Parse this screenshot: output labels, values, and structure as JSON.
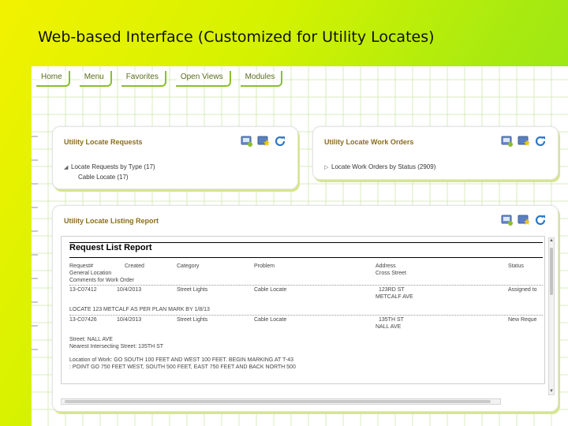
{
  "slide": {
    "title": "Web-based Interface (Customized for Utility Locates)"
  },
  "nav": [
    "Home",
    "Menu",
    "Favorites",
    "Open Views",
    "Modules"
  ],
  "requests_panel": {
    "title": "Utility Locate Requests",
    "tree": [
      {
        "label": "Locate Requests by Type (17)",
        "expanded": true
      },
      {
        "label": "Cable Locate (17)"
      }
    ]
  },
  "workorders_panel": {
    "title": "Utility Locate Work Orders",
    "tree": [
      {
        "label": "Locate Work Orders by Status (2909)",
        "expanded": false
      }
    ]
  },
  "listing_panel": {
    "title": "Utility Locate Listing Report",
    "report": {
      "title": "Request List Report",
      "headers": {
        "request": "Request#",
        "general_location": "General Location",
        "comments": "Comments for Work Order",
        "created": "Created",
        "category": "Category",
        "problem": "Problem",
        "address": "Address",
        "cross_street": "Cross Street",
        "status": "Status"
      },
      "rows": [
        {
          "request": "13-C07412",
          "created": "10/4/2013",
          "category": "Street Lights",
          "problem": "Cable Locate",
          "address": "123RD ST",
          "cross_street": "METCALF AVE",
          "status": "Assigned to",
          "notes": [
            "LOCATE 123 METCALF AS PER PLAN   MARK BY 1/8/13"
          ]
        },
        {
          "request": "13-C07426",
          "created": "10/4/2013",
          "category": "Street Lights",
          "problem": "Cable Locate",
          "address": "135TH ST",
          "cross_street": "NALL AVE",
          "status": "New Reque",
          "notes": [
            "Street: NALL AVE",
            "Nearest Intersecting Street: 135TH ST",
            "Location of Work: GO SOUTH 100 FEET AND WEST 100 FEET. BEGIN MARKING AT T-43",
            ": POINT   GO 750 FEET WEST, SOUTH 500 FEET, EAST 750 FEET AND BACK NORTH 500"
          ]
        }
      ]
    }
  },
  "colors": {
    "accent": "#8bbf2a",
    "panel_title": "#8a6d1f"
  },
  "icons": [
    "view-icon",
    "favorite-icon",
    "refresh-icon"
  ]
}
